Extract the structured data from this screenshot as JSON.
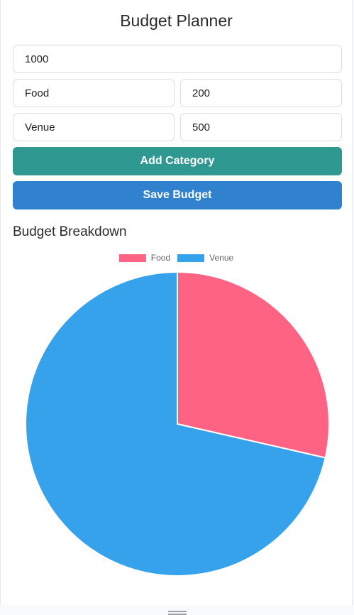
{
  "app": {
    "title": "Budget Planner"
  },
  "form": {
    "total_budget_value": "1000",
    "categories": [
      {
        "name": "Food",
        "amount": "200"
      },
      {
        "name": "Venue",
        "amount": "500"
      }
    ],
    "add_category_label": "Add Category",
    "save_budget_label": "Save Budget"
  },
  "colors": {
    "add_button": "#2f9991",
    "save_button": "#3182ce",
    "food": "#ff6384",
    "venue": "#36a2eb"
  },
  "breakdown": {
    "title": "Budget Breakdown"
  },
  "chart_data": {
    "type": "pie",
    "categories": [
      "Food",
      "Venue"
    ],
    "values": [
      200,
      500
    ],
    "colors": [
      "#ff6384",
      "#36a2eb"
    ],
    "legend_position": "top"
  }
}
